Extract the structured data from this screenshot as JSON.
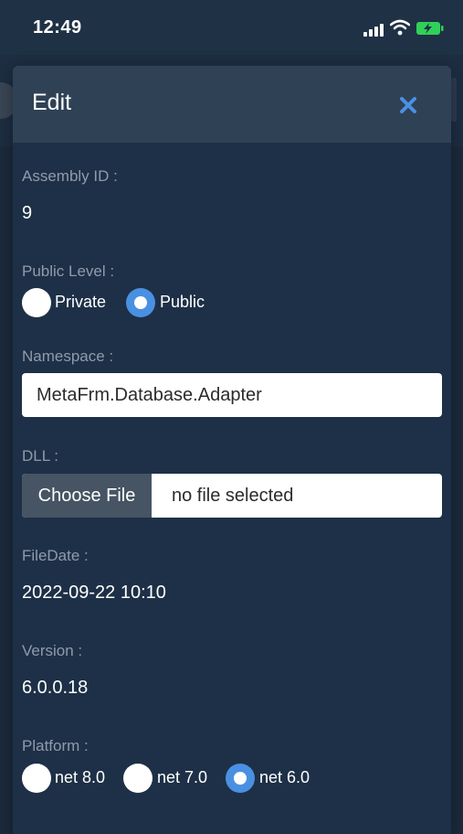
{
  "status_bar": {
    "time": "12:49"
  },
  "modal": {
    "title": "Edit",
    "assembly_id": {
      "label": "Assembly ID :",
      "value": "9"
    },
    "public_level": {
      "label": "Public Level :",
      "options": [
        "Private",
        "Public"
      ],
      "selected": "Public"
    },
    "namespace": {
      "label": "Namespace :",
      "value": "MetaFrm.Database.Adapter"
    },
    "dll": {
      "label": "DLL :",
      "button": "Choose File",
      "status": "no file selected"
    },
    "file_date": {
      "label": "FileDate :",
      "value": "2022-09-22 10:10"
    },
    "version": {
      "label": "Version :",
      "value": "6.0.0.18"
    },
    "platform": {
      "label": "Platform :",
      "options": [
        "net 8.0",
        "net 7.0",
        "net 6.0"
      ],
      "selected": "net 6.0"
    }
  },
  "colors": {
    "accent": "#4a90e2",
    "modal_bg": "#1e3047",
    "header_bg": "#2f4155",
    "label": "#8f9bab",
    "file_button_bg": "#465463"
  }
}
